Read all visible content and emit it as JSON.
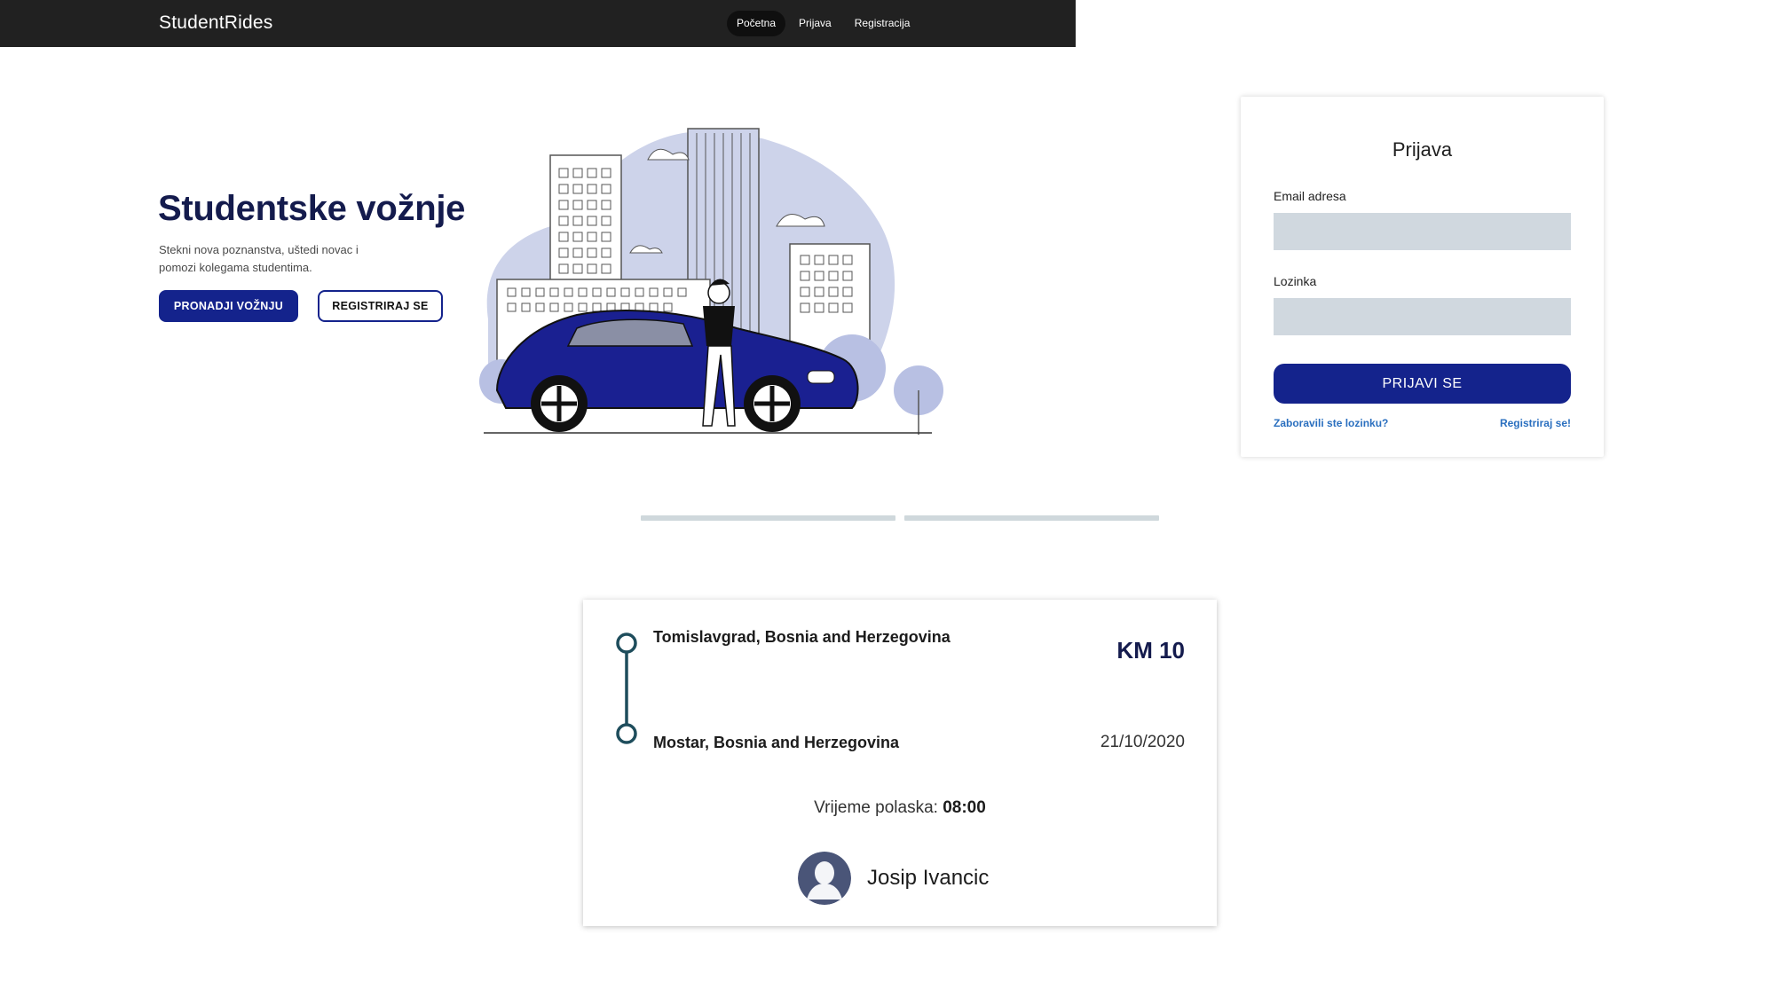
{
  "navbar": {
    "brand": "StudentRides",
    "links": [
      {
        "label": "Početna",
        "active": true
      },
      {
        "label": "Prijava",
        "active": false
      },
      {
        "label": "Registracija",
        "active": false
      }
    ]
  },
  "hero": {
    "title": "Studentske vožnje",
    "subtitle": "Stekni nova poznanstva, uštedi novac i pomozi kolegama studentima.",
    "primary_button": "PRONADJI VOŽNJU",
    "secondary_button": "REGISTRIRAJ SE",
    "illustration_icon": "city-car-illustration"
  },
  "login": {
    "title": "Prijava",
    "email_label": "Email adresa",
    "email_value": "",
    "password_label": "Lozinka",
    "password_value": "",
    "submit_label": "PRIJAVI SE",
    "forgot_link": "Zaboravili ste lozinku?",
    "register_link": "Registriraj se!"
  },
  "pager": {
    "count": 2
  },
  "ride": {
    "from": "Tomislavgrad, Bosnia and Herzegovina",
    "to": "Mostar, Bosnia and Herzegovina",
    "price": "KM 10",
    "date": "21/10/2020",
    "departure_label": "Vrijeme polaska:",
    "departure_time": "08:00",
    "driver_name": "Josip Ivancic",
    "driver_icon": "avatar-icon"
  },
  "colors": {
    "navbar_bg": "#212121",
    "accent": "#14238c",
    "heading": "#141b4d",
    "input_bg": "#d0d8df",
    "link": "#2a6fbf",
    "route_line": "#1e4d5c"
  }
}
